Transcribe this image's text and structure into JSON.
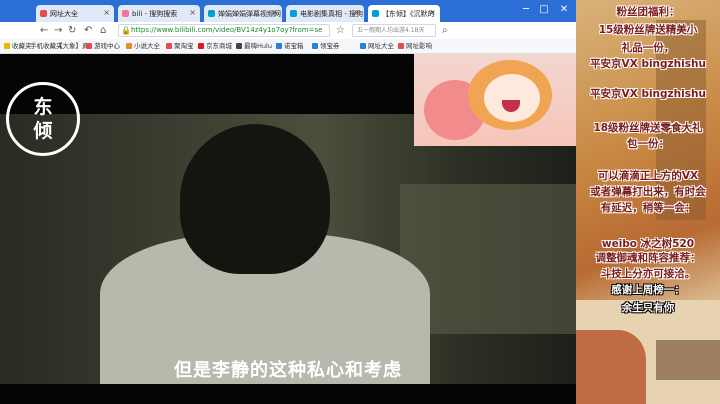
{
  "browser": {
    "logo_text": "S",
    "tabs": [
      {
        "label": "网址大全",
        "active": false,
        "color": "#e54b4b"
      },
      {
        "label": "bili - 搜狗搜索",
        "active": false,
        "color": "#fb7299"
      },
      {
        "label": "婵娟婵娟弹幕视频网",
        "active": false,
        "color": "#00a1d6"
      },
      {
        "label": "电影剧集真相 - 搜狗",
        "active": false,
        "color": "#00a1d6"
      },
      {
        "label": "【东倾】《沉默的",
        "active": true,
        "color": "#00a1d6"
      }
    ],
    "window_buttons": [
      "─",
      "□",
      "✕"
    ],
    "url": "https://www.bilibili.com/video/BV14z4y1o7oy?from=se",
    "search_placeholder": "五一假期人均出游4.1B天",
    "bookmarks": [
      {
        "label": "收藏夹",
        "color": "#f0b400"
      },
      {
        "label": "手机收藏夹",
        "color": "#f0b400"
      },
      {
        "label": "【大象】真",
        "color": "#999999"
      },
      {
        "label": "游戏中心",
        "color": "#e54b4b"
      },
      {
        "label": "小说大全",
        "color": "#f08a24"
      },
      {
        "label": "聚淘宝",
        "color": "#e54b4b"
      },
      {
        "label": "京东商城",
        "color": "#d91a1a"
      },
      {
        "label": "最嗨Hulu",
        "color": "#444444"
      },
      {
        "label": "诺宝箱",
        "color": "#2a7fd6"
      },
      {
        "label": "领宝券",
        "color": "#2a7fd6"
      },
      {
        "label": "网址大全",
        "color": "#2a7fd6"
      },
      {
        "label": "网址影响",
        "color": "#e54b4b"
      }
    ]
  },
  "video": {
    "channel_badge": [
      "东",
      "倾"
    ],
    "subtitle": "但是李静的这种私心和考虑"
  },
  "side_panel": {
    "lines": [
      {
        "text": "粉丝团福利：",
        "style": "red"
      },
      {
        "text": "15级粉丝牌送精美小",
        "style": "red"
      },
      {
        "text": "礼品一份，",
        "style": "red"
      },
      {
        "text": "平安京VX  bingzhishu",
        "style": "red"
      },
      {
        "text": "平安京VX  bingzhishu",
        "style": "red"
      },
      {
        "text": "18级粉丝牌送零食大礼",
        "style": "red"
      },
      {
        "text": "包一份：",
        "style": "red"
      },
      {
        "text": "可以滴滴正上方的VX",
        "style": "red"
      },
      {
        "text": "或者弹幕打出来，有时会",
        "style": "red"
      },
      {
        "text": "有延迟，稍等一会：",
        "style": "red"
      },
      {
        "text": "weibo  冰之树520",
        "style": "red"
      },
      {
        "text": "调整御魂和阵容推荐：",
        "style": "red"
      },
      {
        "text": "斗技上分亦可接洽。",
        "style": "red"
      },
      {
        "text": "感谢上周榜一：",
        "style": "dark"
      },
      {
        "text": "余生只有你",
        "style": "dark"
      }
    ]
  }
}
